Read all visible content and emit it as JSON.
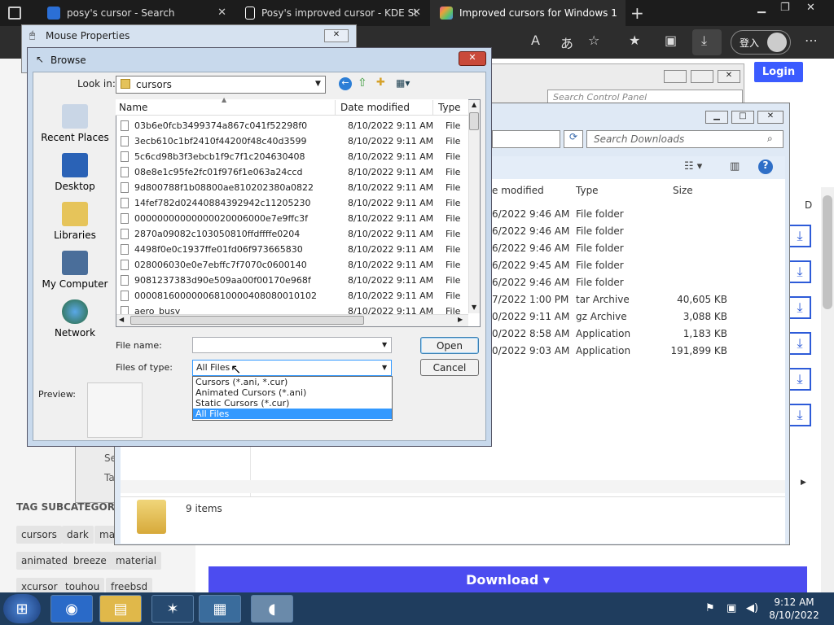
{
  "browser": {
    "tabs": [
      {
        "title": "posy's cursor - Search",
        "icon_color": "#2b6fd6"
      },
      {
        "title": "Posy's improved cursor - KDE St",
        "icon_color": "#ffffff"
      },
      {
        "title": "Improved cursors for Windows 1",
        "icon_color": "#e8a23a"
      }
    ],
    "signin_label": "登入",
    "login_label": "Login"
  },
  "webpage": {
    "tag_header": "TAG SUBCATEGORIES",
    "tags": [
      "cursors",
      "dark",
      "ma",
      "animated",
      "breeze",
      "material",
      "xcursor",
      "touhou",
      "freebsd"
    ],
    "download_label": "Download",
    "left_partial": [
      "Se",
      "Ta"
    ],
    "right_partial": "D"
  },
  "control_panel": {
    "search_placeholder": "Search Control Panel"
  },
  "downloads": {
    "search_placeholder": "Search Downloads",
    "columns": [
      "e modified",
      "Type",
      "Size"
    ],
    "rows": [
      {
        "date": "6/2022 9:46 AM",
        "type": "File folder",
        "size": ""
      },
      {
        "date": "6/2022 9:46 AM",
        "type": "File folder",
        "size": ""
      },
      {
        "date": "6/2022 9:46 AM",
        "type": "File folder",
        "size": ""
      },
      {
        "date": "6/2022 9:45 AM",
        "type": "File folder",
        "size": ""
      },
      {
        "date": "6/2022 9:46 AM",
        "type": "File folder",
        "size": ""
      },
      {
        "date": "7/2022 1:00 PM",
        "type": "tar Archive",
        "size": "40,605 KB"
      },
      {
        "date": "0/2022 9:11 AM",
        "type": "gz Archive",
        "size": "3,088 KB"
      },
      {
        "date": "0/2022 8:58 AM",
        "type": "Application",
        "size": "1,183 KB"
      },
      {
        "date": "0/2022 9:03 AM",
        "type": "Application",
        "size": "191,899 KB"
      }
    ],
    "item_count": "9 items"
  },
  "mouse_properties": {
    "title": "Mouse Properties"
  },
  "browse": {
    "title": "Browse",
    "look_in_label": "Look in:",
    "look_in_value": "cursors",
    "places": [
      "Recent Places",
      "Desktop",
      "Libraries",
      "My Computer",
      "Network"
    ],
    "columns": [
      "Name",
      "Date modified",
      "Type"
    ],
    "files": [
      {
        "name": "03b6e0fcb3499374a867c041f52298f0",
        "date": "8/10/2022 9:11 AM",
        "type": "File"
      },
      {
        "name": "3ecb610c1bf2410f44200f48c40d3599",
        "date": "8/10/2022 9:11 AM",
        "type": "File"
      },
      {
        "name": "5c6cd98b3f3ebcb1f9c7f1c204630408",
        "date": "8/10/2022 9:11 AM",
        "type": "File"
      },
      {
        "name": "08e8e1c95fe2fc01f976f1e063a24ccd",
        "date": "8/10/2022 9:11 AM",
        "type": "File"
      },
      {
        "name": "9d800788f1b08800ae810202380a0822",
        "date": "8/10/2022 9:11 AM",
        "type": "File"
      },
      {
        "name": "14fef782d02440884392942c11205230",
        "date": "8/10/2022 9:11 AM",
        "type": "File"
      },
      {
        "name": "00000000000000020006000e7e9ffc3f",
        "date": "8/10/2022 9:11 AM",
        "type": "File"
      },
      {
        "name": "2870a09082c103050810ffdffffe0204",
        "date": "8/10/2022 9:11 AM",
        "type": "File"
      },
      {
        "name": "4498f0e0c1937ffe01fd06f973665830",
        "date": "8/10/2022 9:11 AM",
        "type": "File"
      },
      {
        "name": "028006030e0e7ebffc7f7070c0600140",
        "date": "8/10/2022 9:11 AM",
        "type": "File"
      },
      {
        "name": "9081237383d90e509aa00f00170e968f",
        "date": "8/10/2022 9:11 AM",
        "type": "File"
      },
      {
        "name": "00008160000006810000408080010102",
        "date": "8/10/2022 9:11 AM",
        "type": "File"
      },
      {
        "name": "aero_busy",
        "date": "8/10/2022 9:11 AM",
        "type": "File"
      }
    ],
    "file_name_label": "File name:",
    "file_name_value": "",
    "files_of_type_label": "Files of type:",
    "files_of_type_value": "All Files",
    "type_options": [
      "Cursors (*.ani, *.cur)",
      "Animated Cursors (*.ani)",
      "Static Cursors (*.cur)",
      "All Files"
    ],
    "preview_label": "Preview:",
    "open_label": "Open",
    "cancel_label": "Cancel"
  },
  "taskbar": {
    "time": "9:12 AM",
    "date": "8/10/2022"
  }
}
